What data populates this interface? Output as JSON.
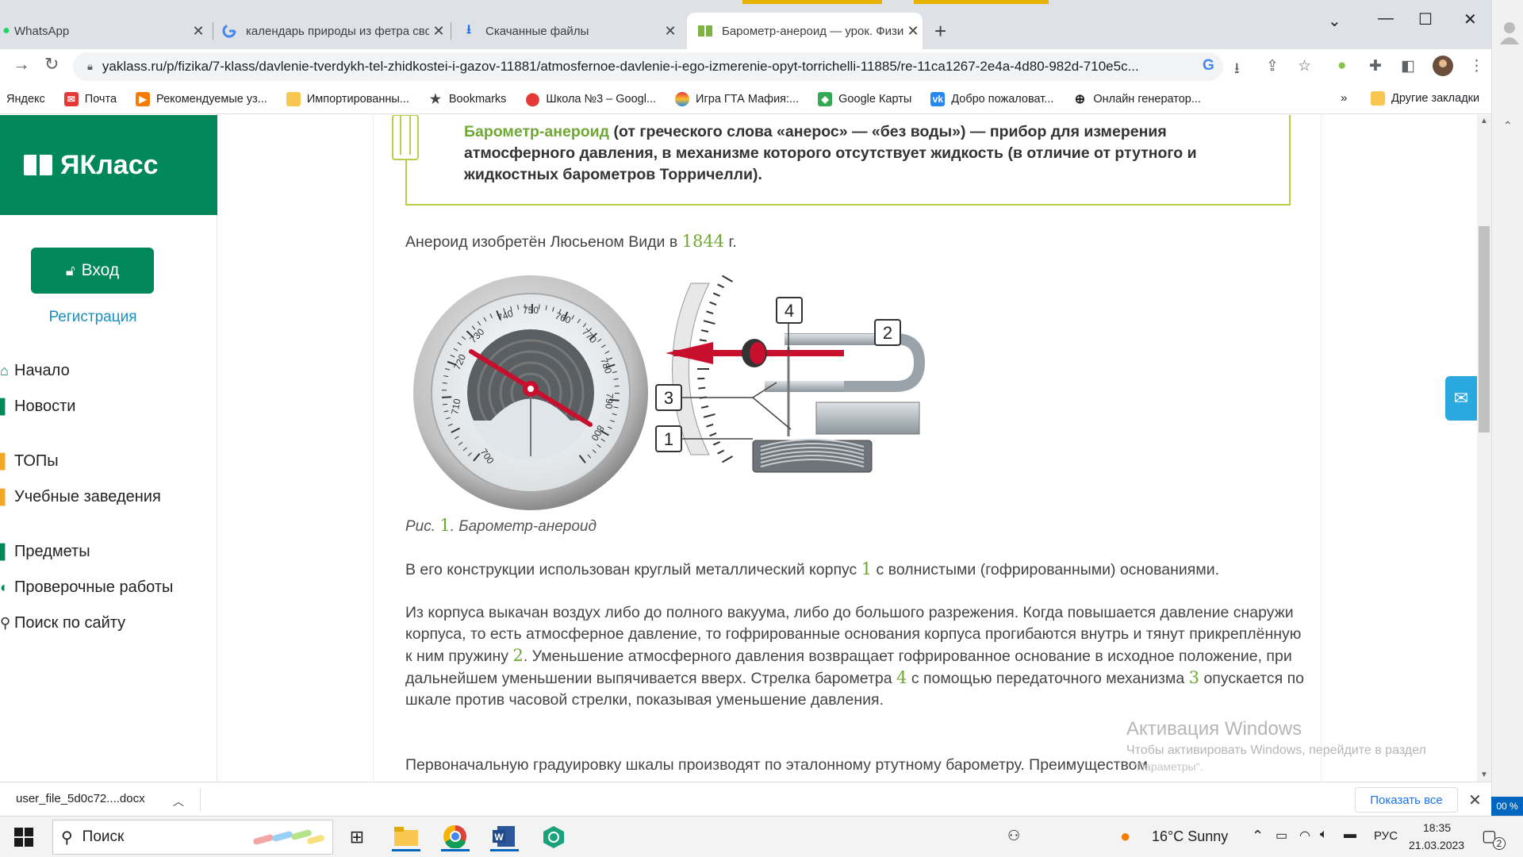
{
  "tabs": [
    {
      "title": "WhatsApp",
      "close": "✕"
    },
    {
      "title": "календарь природы из фетра своими",
      "close": "✕"
    },
    {
      "title": "Скачанные файлы",
      "close": "✕"
    },
    {
      "title": "Барометр-анероид — урок. Физика",
      "close": "✕"
    }
  ],
  "newtab": "+",
  "window_controls": {
    "chevron": "⌄",
    "minimize": "—",
    "maximize": "☐",
    "close": "✕"
  },
  "url": "yaklass.ru/p/fizika/7-klass/davlenie-tverdykh-tel-zhidkostei-i-gazov-11881/atmosfernoe-davlenie-i-ego-izmerenie-opyt-torrichelli-11885/re-11ca1267-2e4a-4d80-982d-710e5c...",
  "bookmarks": [
    "Яндекс",
    "Почта",
    "Рекомендуемые уз...",
    "Импортированны...",
    "Bookmarks",
    "Школа №3 – Googl...",
    "Игра ГТА Мафия:...",
    "Google Карты",
    "Добро пожаловат...",
    "Онлайн генератор..."
  ],
  "bookmarks_more": "»",
  "bookmarks_other": "Другие закладки",
  "sidebar": {
    "logo": "ЯКласс",
    "login": "Вход",
    "register": "Регистрация",
    "nav": [
      "Начало",
      "Новости",
      "ТОПы",
      "Учебные заведения",
      "Предметы",
      "Проверочные работы",
      "Поиск по сайту"
    ]
  },
  "content": {
    "def_term": "Барометр-анероид",
    "def_rest": " (от греческого слова «анерос» — «без воды») — прибор для измерения атмосферного давления, в механизме которого отсутствует жидкость (в отличие от ртутного и жидкостных барометров Торричелли).",
    "p1_a": "Анероид изобретён Люсьеном Види в ",
    "p1_year": "1844",
    "p1_b": " г.",
    "caption_a": "Рис. ",
    "caption_num": "1",
    "caption_b": ". Барометр-анероид",
    "p2_a": "В его конструкции использован круглый металлический корпус ",
    "p2_n": "1",
    "p2_b": " с волнистыми (гофрированными) основаниями.",
    "p3_a": "Из корпуса выкачан воздух либо до полного вакуума, либо до большого разрежения. Когда повышается давление снаружи корпуса, то есть атмосферное давление, то гофрированные основания корпуса прогибаются внутрь и тянут прикреплённую к ним пружину ",
    "p3_n2": "2",
    "p3_b": ". Уменьшение атмосферного давления возвращает гофрированное основание в исходное положение, при дальнейшем уменьшении выпячивается вверх. Стрелка барометра ",
    "p3_n4": "4",
    "p3_c": " с помощью передаточного механизма ",
    "p3_n3": "3",
    "p3_d": " опускается по шкале против часовой стрелки, показывая уменьшение давления.",
    "p4": "Первоначальную градуировку шкалы производят по эталонному ртутному барометру. Преимуществом"
  },
  "figure": {
    "dial_labels": [
      "700",
      "710",
      "720",
      "730",
      "740",
      "750",
      "760",
      "770",
      "780",
      "790",
      "800"
    ],
    "callouts": [
      "1",
      "2",
      "3",
      "4"
    ]
  },
  "activation": {
    "title": "Активация Windows",
    "line": "Чтобы активировать Windows, перейдите в раздел",
    "line2": "\"Параметры\"."
  },
  "download": {
    "file": "user_file_5d0c72....docx",
    "show_all": "Показать все"
  },
  "zoom_badge": "00 %",
  "taskbar": {
    "search": "Поиск",
    "weather": "16°C  Sunny",
    "lang": "РУС",
    "time": "18:35",
    "date": "21.03.2023",
    "notif": "2"
  },
  "colors": {
    "brand": "#00875a",
    "accent_green": "#6fa832",
    "link": "#1a8fbf",
    "pointer_red": "#c8102e"
  }
}
